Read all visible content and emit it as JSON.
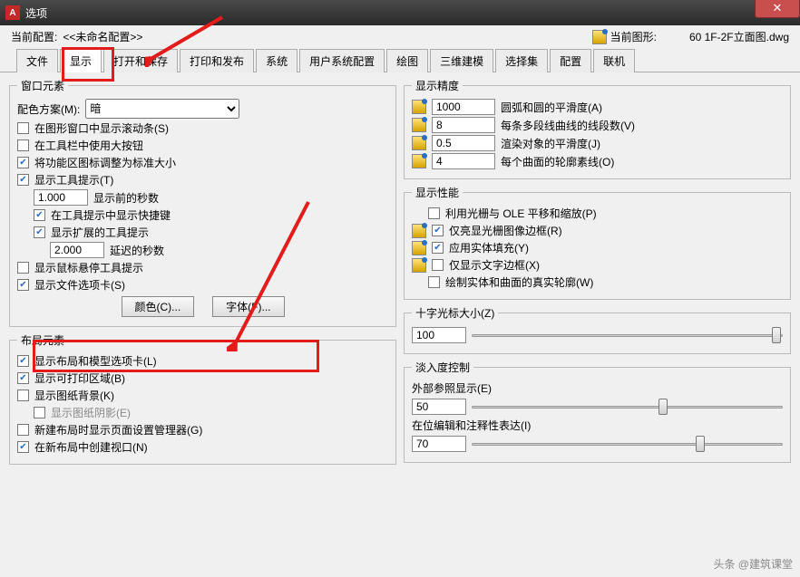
{
  "titlebar": {
    "title": "选项",
    "logo": "A"
  },
  "profile": {
    "current_label": "当前配置:",
    "current_value": "<<未命名配置>>",
    "drawing_label": "当前图形:",
    "drawing_value": "60 1F-2F立面图.dwg"
  },
  "tabs": [
    "文件",
    "显示",
    "打开和保存",
    "打印和发布",
    "系统",
    "用户系统配置",
    "绘图",
    "三维建模",
    "选择集",
    "配置",
    "联机"
  ],
  "active_tab": "显示",
  "window_elements": {
    "legend": "窗口元素",
    "scheme_label": "配色方案(M):",
    "scheme_value": "暗",
    "scrollbars": "在图形窗口中显示滚动条(S)",
    "big_buttons": "在工具栏中使用大按钮",
    "ribbon_std": "将功能区图标调整为标准大小",
    "tooltips": "显示工具提示(T)",
    "seconds_before": "1.000",
    "seconds_before_label": "显示前的秒数",
    "shortcuts": "在工具提示中显示快捷键",
    "ext_tooltips": "显示扩展的工具提示",
    "delay": "2.000",
    "delay_label": "延迟的秒数",
    "hover": "显示鼠标悬停工具提示",
    "file_tabs": "显示文件选项卡(S)",
    "color_btn": "颜色(C)...",
    "font_btn": "字体(F)..."
  },
  "layout_elements": {
    "legend": "布局元素",
    "l1": "显示布局和模型选项卡(L)",
    "l2": "显示可打印区域(B)",
    "l3": "显示图纸背景(K)",
    "l3a": "显示图纸阴影(E)",
    "l4": "新建布局时显示页面设置管理器(G)",
    "l5": "在新布局中创建视口(N)"
  },
  "precision": {
    "legend": "显示精度",
    "p1_val": "1000",
    "p1": "圆弧和圆的平滑度(A)",
    "p2_val": "8",
    "p2": "每条多段线曲线的线段数(V)",
    "p3_val": "0.5",
    "p3": "渲染对象的平滑度(J)",
    "p4_val": "4",
    "p4": "每个曲面的轮廓素线(O)"
  },
  "performance": {
    "legend": "显示性能",
    "f1": "利用光栅与 OLE 平移和缩放(P)",
    "f2": "仅亮显光栅图像边框(R)",
    "f3": "应用实体填充(Y)",
    "f4": "仅显示文字边框(X)",
    "f5": "绘制实体和曲面的真实轮廓(W)"
  },
  "crosshair": {
    "legend": "十字光标大小(Z)",
    "value": "100"
  },
  "fade": {
    "legend": "淡入度控制",
    "xref_label": "外部参照显示(E)",
    "xref_val": "50",
    "anno_label": "在位编辑和注释性表达(I)",
    "anno_val": "70"
  },
  "watermark": "头条 @建筑课堂"
}
